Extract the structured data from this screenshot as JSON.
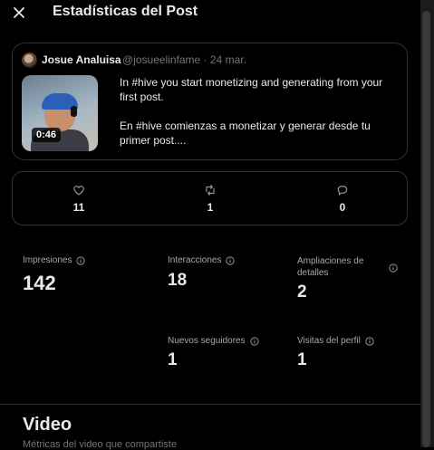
{
  "header": {
    "title": "Estadísticas del Post",
    "close_icon": "close-icon"
  },
  "post": {
    "author": "Josue Analuisa",
    "handle_date": "@josueelinfame · 24 mar.",
    "video_duration": "0:46",
    "text_en": "In #hive you start monetizing and generating from your first post.",
    "text_es": "En #hive comienzas a monetizar y generar desde tu primer post...."
  },
  "engagement": {
    "likes": {
      "icon": "heart-icon",
      "value": "11"
    },
    "reposts": {
      "icon": "repost-icon",
      "value": "1"
    },
    "replies": {
      "icon": "reply-icon",
      "value": "0"
    }
  },
  "metrics": {
    "impressions": {
      "label": "Impresiones",
      "value": "142"
    },
    "interactions": {
      "label": "Interacciones",
      "value": "18"
    },
    "detail_expands": {
      "label": "Ampliaciones de detalles",
      "value": "2"
    },
    "new_followers": {
      "label": "Nuevos seguidores",
      "value": "1"
    },
    "profile_visits": {
      "label": "Visitas del perfil",
      "value": "1"
    }
  },
  "video_section": {
    "title": "Video",
    "subtitle": "Métricas del video que compartiste"
  },
  "colors": {
    "background": "#000000",
    "border": "#2f3336",
    "text": "#e7e9ea",
    "muted": "#71767b"
  }
}
